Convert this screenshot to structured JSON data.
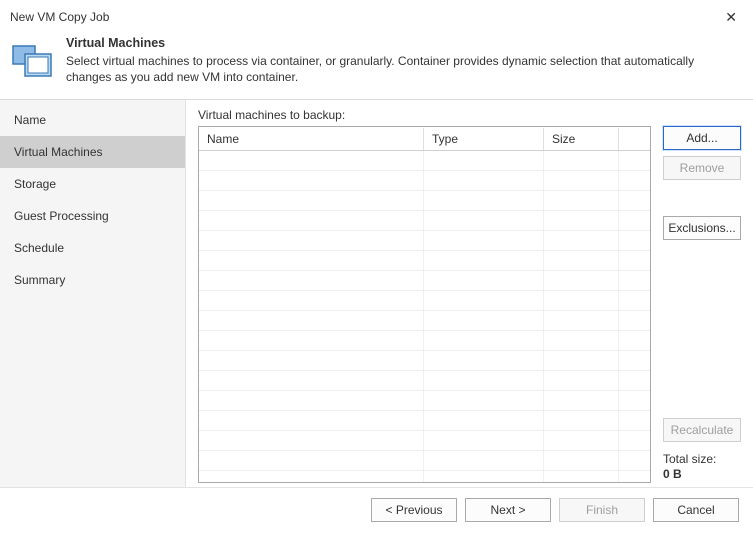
{
  "window": {
    "title": "New VM Copy Job"
  },
  "header": {
    "step_title": "Virtual Machines",
    "step_desc": "Select virtual machines to process via container, or granularly. Container provides dynamic selection that automatically changes as you add new VM into container."
  },
  "sidebar": {
    "items": [
      {
        "label": "Name",
        "active": false
      },
      {
        "label": "Virtual Machines",
        "active": true
      },
      {
        "label": "Storage",
        "active": false
      },
      {
        "label": "Guest Processing",
        "active": false
      },
      {
        "label": "Schedule",
        "active": false
      },
      {
        "label": "Summary",
        "active": false
      }
    ]
  },
  "main": {
    "list_label": "Virtual machines to backup:",
    "columns": {
      "name": "Name",
      "type": "Type",
      "size": "Size"
    },
    "rows": [],
    "buttons": {
      "add": "Add...",
      "remove": "Remove",
      "exclusions": "Exclusions...",
      "recalculate": "Recalculate"
    },
    "total_label": "Total size:",
    "total_value": "0 B"
  },
  "footer": {
    "previous": "< Previous",
    "next": "Next >",
    "finish": "Finish",
    "cancel": "Cancel"
  }
}
